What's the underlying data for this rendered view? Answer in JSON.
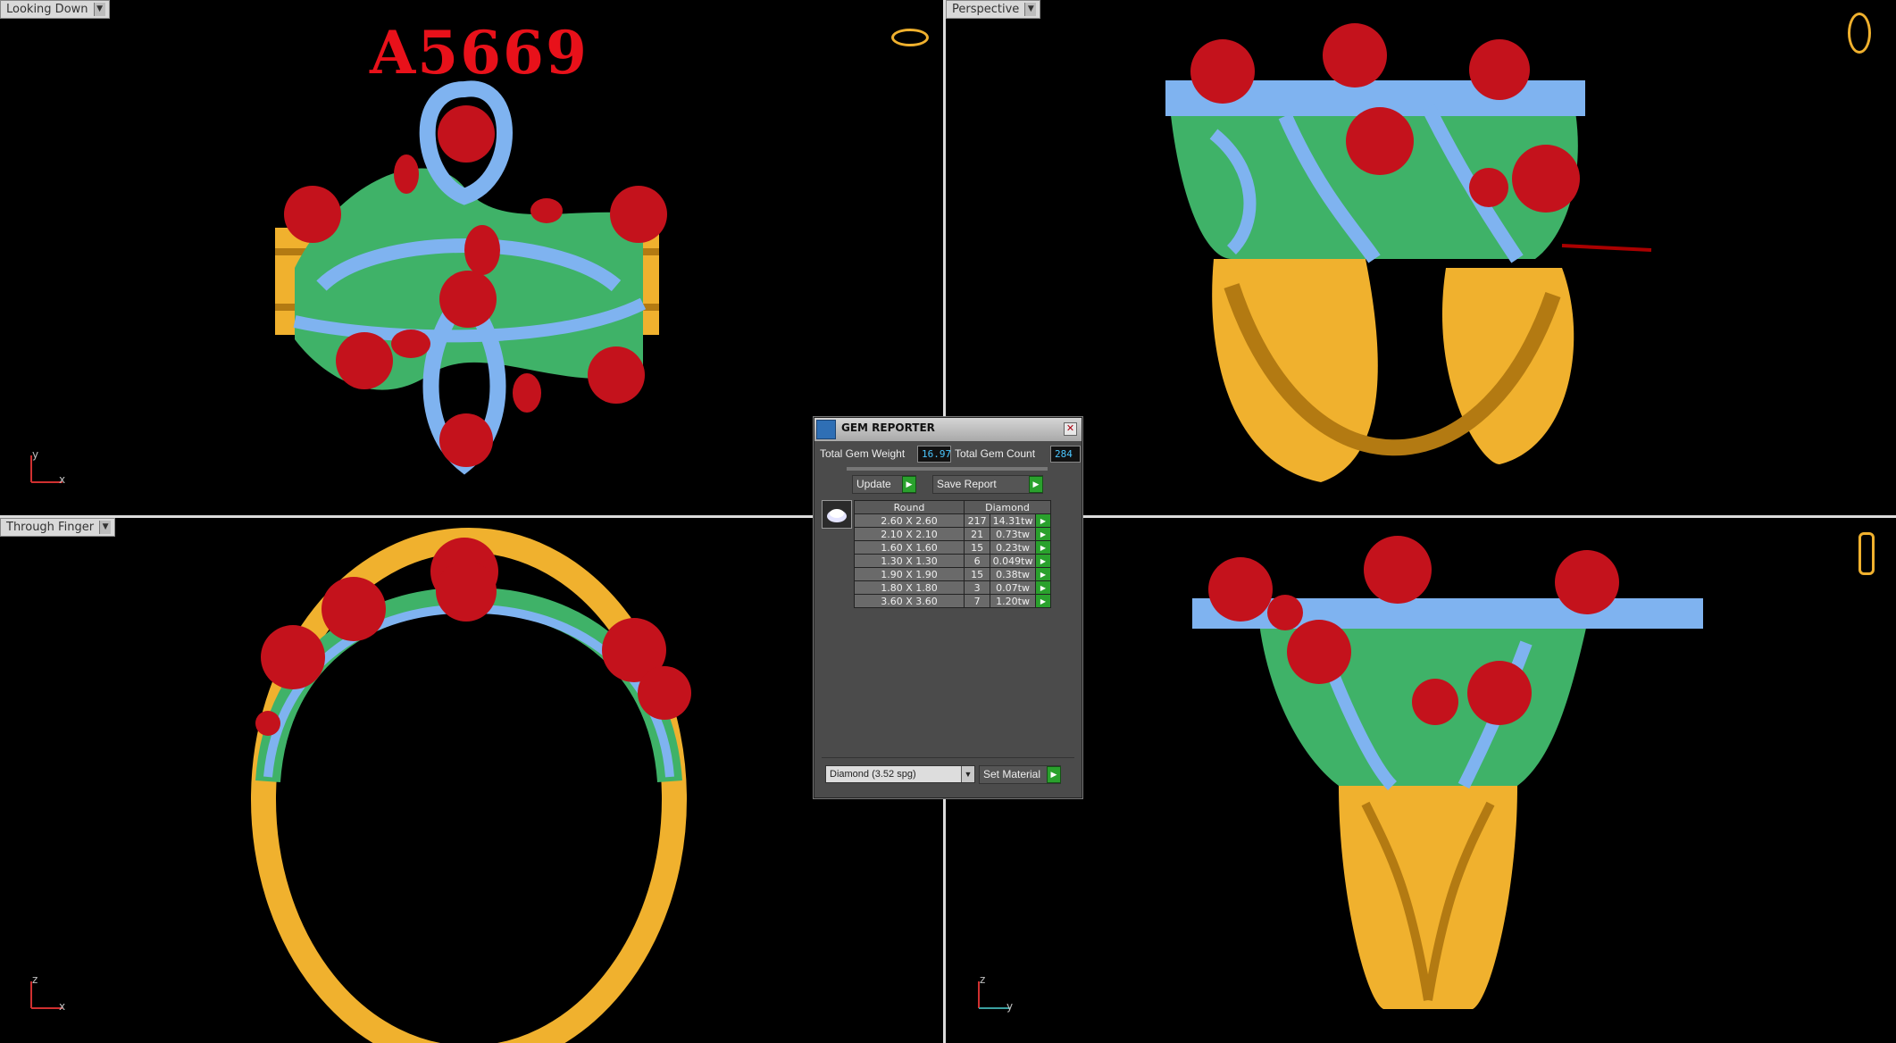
{
  "viewports": {
    "top_left": {
      "label": "Looking Down",
      "axis_v": "y",
      "axis_h": "x"
    },
    "top_right": {
      "label": "Perspective"
    },
    "bottom_left": {
      "label": "Through Finger",
      "axis_v": "z",
      "axis_h": "x"
    },
    "bottom_right": {
      "axis_v": "z",
      "axis_h": "y"
    }
  },
  "design_id": "A5669",
  "gem_reporter": {
    "title": "GEM REPORTER",
    "total_weight_label": "Total Gem Weight",
    "total_weight_value": "16.97",
    "total_count_label": "Total Gem Count",
    "total_count_value": "284",
    "update_label": "Update",
    "save_label": "Save Report",
    "table_headers": {
      "shape": "Round",
      "material": "Diamond"
    },
    "rows": [
      {
        "size": "2.60 X 2.60",
        "count": "217",
        "weight": "14.31tw"
      },
      {
        "size": "2.10 X 2.10",
        "count": "21",
        "weight": "0.73tw"
      },
      {
        "size": "1.60 X 1.60",
        "count": "15",
        "weight": "0.23tw"
      },
      {
        "size": "1.30 X 1.30",
        "count": "6",
        "weight": "0.049tw"
      },
      {
        "size": "1.90 X 1.90",
        "count": "15",
        "weight": "0.38tw"
      },
      {
        "size": "1.80 X 1.80",
        "count": "3",
        "weight": "0.07tw"
      },
      {
        "size": "3.60 X 3.60",
        "count": "7",
        "weight": "1.20tw"
      }
    ],
    "material_select": "Diamond    (3.52 spg)",
    "set_material_label": "Set Material"
  },
  "colors": {
    "metal": "#f0b12e",
    "frame": "#3fb268",
    "pave": "#7fb3f0",
    "stone": "#c4121c",
    "title_text": "#e8111a"
  }
}
